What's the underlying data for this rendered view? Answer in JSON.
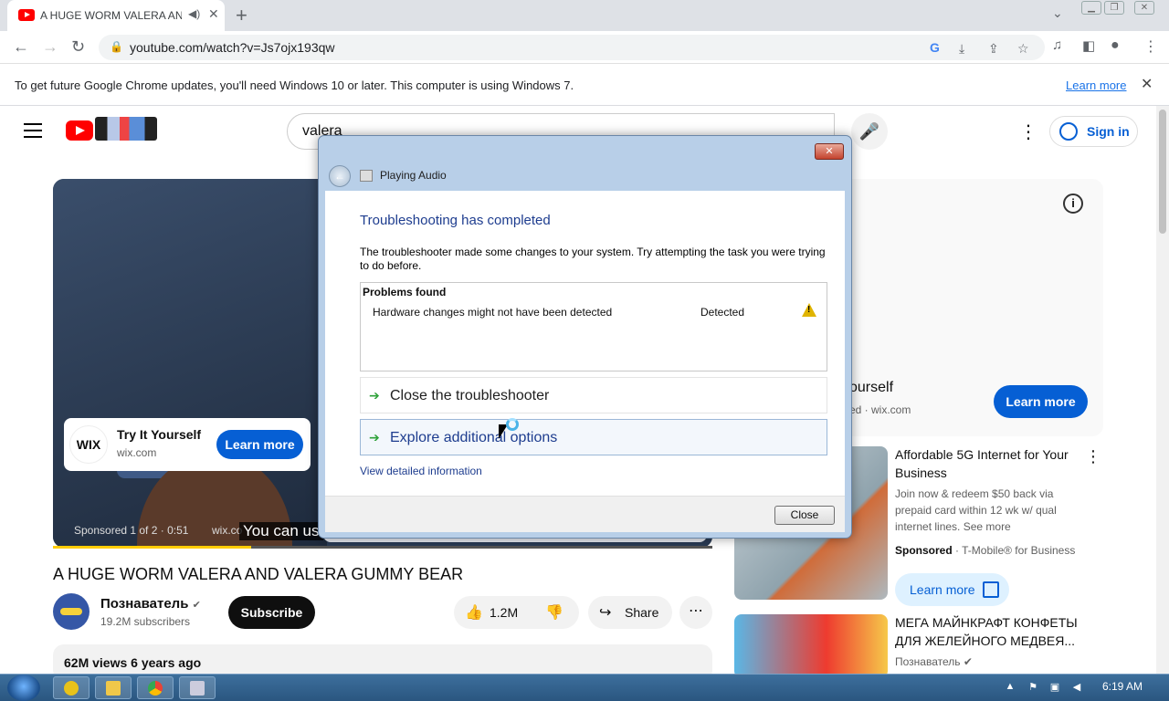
{
  "browser": {
    "tab_title": "A HUGE WORM VALERA AN",
    "tab_audio_icon": "speaker-icon",
    "url": "youtube.com/watch?v=Js7ojx193qw",
    "infobar_message": "To get future Google Chrome updates, you'll need Windows 10 or later. This computer is using Windows 7.",
    "infobar_link": "Learn more"
  },
  "youtube": {
    "search_query": "valera",
    "sign_in": "Sign in",
    "video": {
      "ad_title": "Try It Yourself",
      "ad_domain": "wix.com",
      "ad_logo": "WIX",
      "ad_button": "Learn more",
      "sponsored_text": "Sponsored 1 of 2 · 0:51",
      "wix_overlay": "wix.co",
      "caption": "You can us",
      "progress": 0.3
    },
    "title": "A HUGE WORM VALERA AND VALERA GUMMY BEAR",
    "channel": "Познаватель",
    "subscribers": "19.2M subscribers",
    "subscribe": "Subscribe",
    "likes": "1.2M",
    "share": "Share",
    "views_line": "62M views  6 years ago",
    "sidebar": {
      "ad_title": "ourself",
      "ad_domain": "ed · wix.com",
      "ad_button": "Learn more",
      "card1_title": "Affordable 5G Internet for Your Business",
      "card1_desc": "Join now & redeem $50 back via prepaid card within 12 wk w/ qual internet lines. See more",
      "card1_sponsored": "Sponsored",
      "card1_advertiser": " · T-Mobile® for Business",
      "card1_button": "Learn more",
      "card2_title": "МЕГА МАЙНКРАФТ КОНФЕТЫ ДЛЯ ЖЕЛЕЙНОГО МЕДВЕЯ...",
      "card2_channel": "Познаватель"
    }
  },
  "dialog": {
    "window_title": "Playing Audio",
    "heading": "Troubleshooting has completed",
    "paragraph": "The troubleshooter made some changes to your system. Try attempting the task you were trying to do before.",
    "problems_header": "Problems found",
    "problem": "Hardware changes might not have been detected",
    "problem_status": "Detected",
    "option1": "Close the troubleshooter",
    "option2": "Explore additional options",
    "details_link": "View detailed information",
    "close_button": "Close"
  },
  "taskbar": {
    "clock": "6:19 AM"
  }
}
